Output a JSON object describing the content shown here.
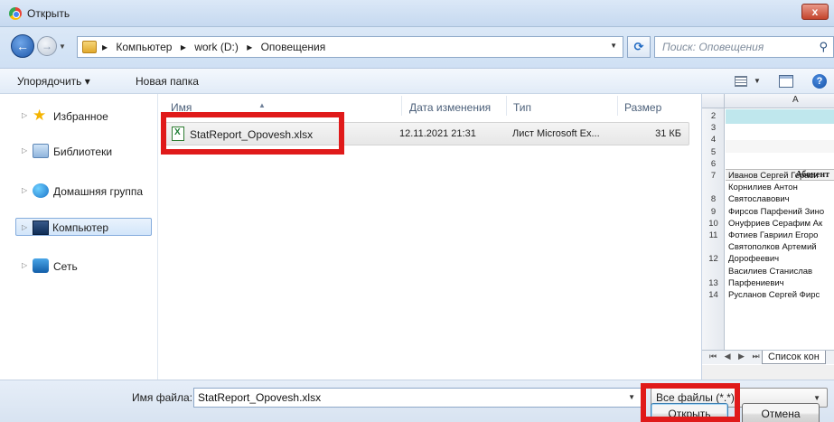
{
  "window": {
    "title": "Открыть",
    "close_label": "x"
  },
  "address": {
    "crumbs": [
      "Компьютер",
      "▸",
      "work (D:)",
      "▸",
      "Оповещения"
    ],
    "lead_arrow": "▸",
    "search_placeholder": "Поиск: Оповещения"
  },
  "toolbar": {
    "organize_label": "Упорядочить ▾",
    "new_folder_label": "Новая папка"
  },
  "navigation": {
    "items": [
      {
        "label": "Избранное",
        "icon": "star-icon"
      },
      {
        "label": "Библиотеки",
        "icon": "library-icon"
      },
      {
        "label": "Домашняя группа",
        "icon": "homegroup-icon"
      },
      {
        "label": "Компьютер",
        "icon": "computer-icon",
        "selected": true
      },
      {
        "label": "Сеть",
        "icon": "network-icon"
      }
    ]
  },
  "file_list": {
    "columns": [
      "Имя",
      "Дата изменения",
      "Тип",
      "Размер"
    ],
    "rows": [
      {
        "name": "StatReport_Opovesh.xlsx",
        "date": "12.11.2021 21:31",
        "type": "Лист Microsoft Ex...",
        "size": "31 КБ"
      }
    ]
  },
  "preview": {
    "column_label": "A",
    "header_text": "Абонент",
    "rows": [
      {
        "n": "2",
        "v": ""
      },
      {
        "n": "3",
        "v": ""
      },
      {
        "n": "4",
        "v": ""
      },
      {
        "n": "5",
        "v": ""
      },
      {
        "n": "6",
        "v": ""
      },
      {
        "n": "7",
        "v": "Иванов Сергей Гераси"
      },
      {
        "n": "",
        "v": "Корнилиев Антон"
      },
      {
        "n": "8",
        "v": "Святославович"
      },
      {
        "n": "9",
        "v": "Фирсов Парфений Зино"
      },
      {
        "n": "10",
        "v": "Онуфриев Серафим Ак"
      },
      {
        "n": "11",
        "v": "Фотиев Гавриил Егоро"
      },
      {
        "n": "",
        "v": "Святополков Артемий"
      },
      {
        "n": "12",
        "v": "Дорофеевич"
      },
      {
        "n": "",
        "v": "Василиев Станислав"
      },
      {
        "n": "13",
        "v": "Парфениевич"
      },
      {
        "n": "14",
        "v": "Русланов Сергей Фирс"
      }
    ],
    "sheet_tab": "Список кон",
    "tab_arrows": "⏮ ◀ ▶ ⏭"
  },
  "bottom": {
    "filename_label": "Имя файла:",
    "filename_value": "StatReport_Opovesh.xlsx",
    "filter_value": "Все файлы (*.*)",
    "open_label": "Открыть",
    "cancel_label": "Отмена"
  },
  "colors": {
    "highlight": "#e01a1a",
    "title_bar": "#c6d9f0",
    "selection": "#d2e5fa"
  }
}
